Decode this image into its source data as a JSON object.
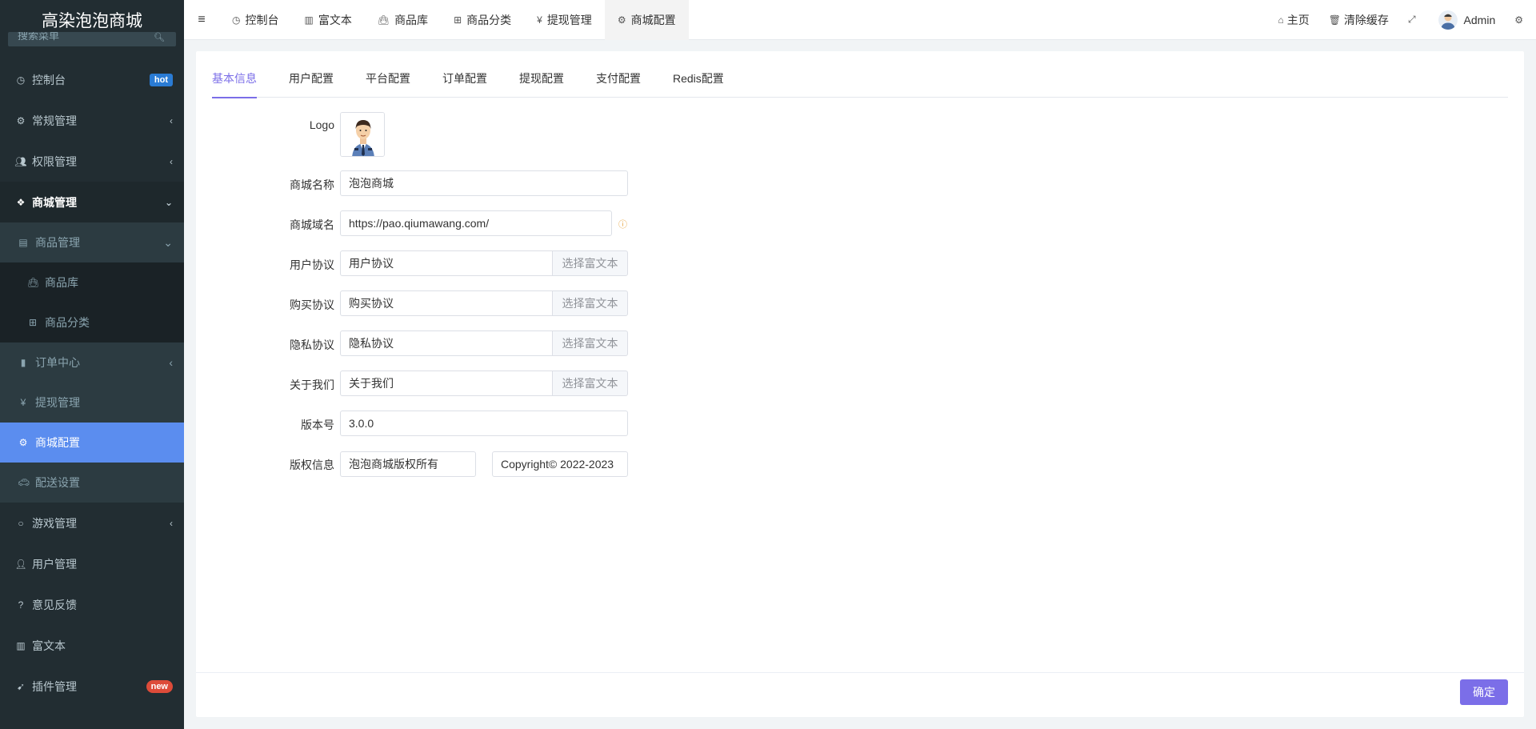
{
  "app": {
    "title": "高染泡泡商城"
  },
  "search": {
    "placeholder": "搜索菜单"
  },
  "sidebar": {
    "items": [
      {
        "label": "控制台",
        "icon": "dashboard-icon",
        "badge": "hot"
      },
      {
        "label": "常规管理",
        "icon": "cogs-icon"
      },
      {
        "label": "权限管理",
        "icon": "users-icon"
      },
      {
        "label": "商城管理",
        "icon": "dropbox-icon"
      },
      {
        "label": "商品管理",
        "icon": "archive-icon"
      },
      {
        "label": "商品库",
        "icon": "shopping-bag-icon"
      },
      {
        "label": "商品分类",
        "icon": "sitemap-icon"
      },
      {
        "label": "订单中心",
        "icon": "file-icon"
      },
      {
        "label": "提现管理",
        "icon": "yen-icon"
      },
      {
        "label": "商城配置",
        "icon": "cogs-icon"
      },
      {
        "label": "配送设置",
        "icon": "car-icon"
      },
      {
        "label": "游戏管理",
        "icon": "circle-icon"
      },
      {
        "label": "用户管理",
        "icon": "user-icon"
      },
      {
        "label": "意见反馈",
        "icon": "question-circle-icon"
      },
      {
        "label": "富文本",
        "icon": "book-icon"
      },
      {
        "label": "插件管理",
        "icon": "rocket-icon",
        "badge": "new"
      }
    ]
  },
  "topnav": {
    "tabs": [
      {
        "label": "控制台",
        "icon": "dashboard-icon"
      },
      {
        "label": "富文本",
        "icon": "book-icon"
      },
      {
        "label": "商品库",
        "icon": "shopping-bag-icon"
      },
      {
        "label": "商品分类",
        "icon": "sitemap-icon"
      },
      {
        "label": "提现管理",
        "icon": "yen-icon"
      },
      {
        "label": "商城配置",
        "icon": "cogs-icon"
      }
    ],
    "right": {
      "home": "主页",
      "clear_cache": "清除缓存",
      "user": "Admin"
    }
  },
  "panel": {
    "tabs": [
      "基本信息",
      "用户配置",
      "平台配置",
      "订单配置",
      "提现配置",
      "支付配置",
      "Redis配置"
    ],
    "form": {
      "logo_label": "Logo",
      "shop_name_label": "商城名称",
      "shop_name_value": "泡泡商城",
      "domain_label": "商城域名",
      "domain_value": "https://pao.qiumawang.com/",
      "user_agreement_label": "用户协议",
      "user_agreement_value": "用户协议",
      "purchase_agreement_label": "购买协议",
      "purchase_agreement_value": "购买协议",
      "privacy_label": "隐私协议",
      "privacy_value": "隐私协议",
      "about_label": "关于我们",
      "about_value": "关于我们",
      "select_richtext": "选择富文本",
      "version_label": "版本号",
      "version_value": "3.0.0",
      "copyright_label": "版权信息",
      "copyright_value1": "泡泡商城版权所有",
      "copyright_value2": "Copyright© 2022-2023"
    },
    "confirm": "确定"
  },
  "colors": {
    "accent": "#7b6ee8",
    "sidebar_bg": "#222d32",
    "sidebar_active": "#5b8def"
  }
}
